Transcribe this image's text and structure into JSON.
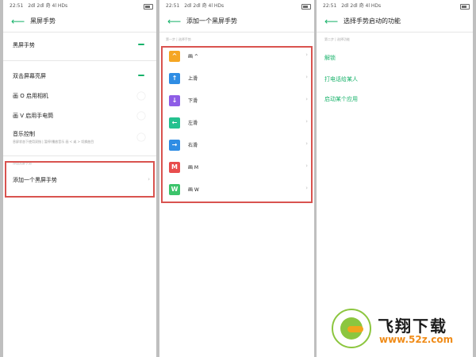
{
  "colors": {
    "accent": "#17b26a",
    "highlight_box": "#d9534f"
  },
  "panel1": {
    "status": {
      "time": "22:51",
      "signal": "2dl 2dl 奇 4l HDs"
    },
    "header": {
      "back_icon": "back-arrow-icon",
      "title": "黑屏手势"
    },
    "rows": [
      {
        "label": "黑屏手势",
        "toggle": "on"
      },
      {
        "label": "双击屏幕亮屏",
        "toggle": "on"
      },
      {
        "label": "画 O 启用相机",
        "toggle": "off"
      },
      {
        "label": "画 V 启用手电筒",
        "toggle": "off"
      },
      {
        "label": "音乐控制",
        "sublabel": "息屏状态下使用双指 | 暂停/播放音乐     画 < 或 > 切换曲目",
        "toggle": "off"
      }
    ],
    "section_hint": "添加黑屏手势",
    "add_item": {
      "label": "添加一个黑屏手势"
    }
  },
  "panel2": {
    "status": {
      "time": "22:51",
      "signal": "2dl 2dl 奇 4l HDs"
    },
    "header": {
      "back_icon": "back-arrow-icon",
      "title": "添加一个黑屏手势"
    },
    "section_hint": "第一步 | 选择手势",
    "gestures": [
      {
        "icon_text": "^",
        "color": "#f5a623",
        "label": "画 ^"
      },
      {
        "icon_text": "↑",
        "color": "#2f8de4",
        "label": "上滑"
      },
      {
        "icon_text": "↓",
        "color": "#8e5de6",
        "label": "下滑"
      },
      {
        "icon_text": "←",
        "color": "#25c18f",
        "label": "左滑"
      },
      {
        "icon_text": "→",
        "color": "#2f8de4",
        "label": "右滑"
      },
      {
        "icon_text": "M",
        "color": "#e84d4d",
        "label": "画 M"
      },
      {
        "icon_text": "W",
        "color": "#3cc46b",
        "label": "画 W"
      }
    ]
  },
  "panel3": {
    "status": {
      "time": "22:51",
      "signal": "2dl 2dl 奇 4l HDs"
    },
    "header": {
      "back_icon": "back-arrow-icon",
      "title": "选择手势启动的功能"
    },
    "section_hint": "第二步 | 选择功能",
    "functions": [
      {
        "label": "解锁"
      },
      {
        "label": "打电话给某人"
      },
      {
        "label": "启动某个应用"
      }
    ]
  },
  "watermark": {
    "name": "飞翔下载",
    "url": "www.52z.com"
  }
}
